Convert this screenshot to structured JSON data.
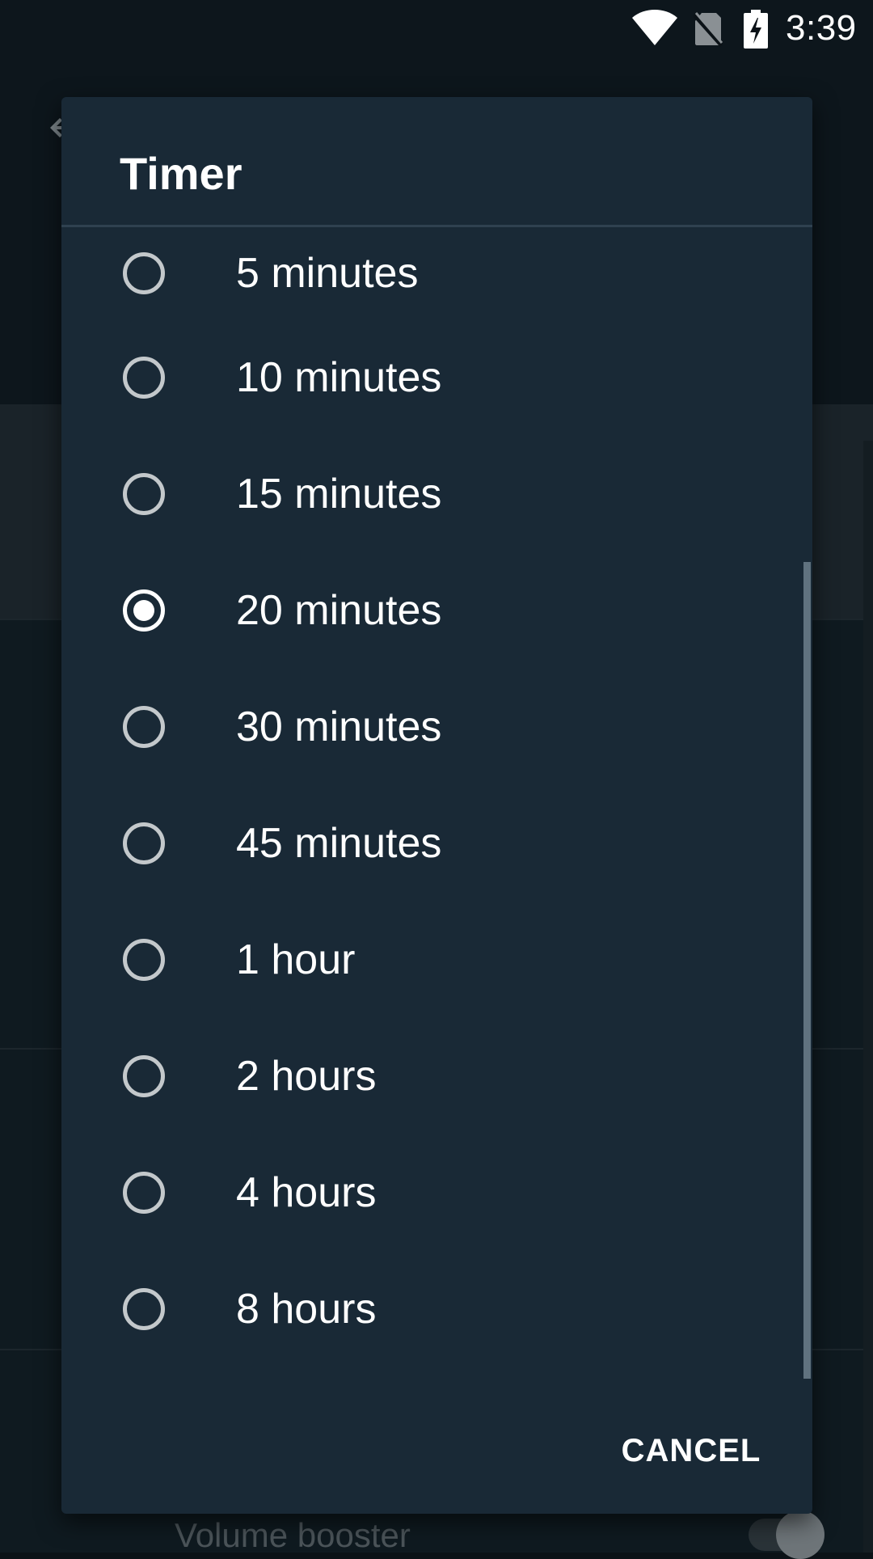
{
  "status_bar": {
    "time": "3:39",
    "icons": [
      "wifi-icon",
      "no-sim-icon",
      "battery-charging-icon"
    ]
  },
  "background": {
    "volume_booster_label": "Volume booster"
  },
  "dialog": {
    "title": "Timer",
    "options": [
      {
        "label": "5 minutes",
        "selected": false
      },
      {
        "label": "10 minutes",
        "selected": false
      },
      {
        "label": "15 minutes",
        "selected": false
      },
      {
        "label": "20 minutes",
        "selected": true
      },
      {
        "label": "30 minutes",
        "selected": false
      },
      {
        "label": "45 minutes",
        "selected": false
      },
      {
        "label": "1 hour",
        "selected": false
      },
      {
        "label": "2 hours",
        "selected": false
      },
      {
        "label": "4 hours",
        "selected": false
      },
      {
        "label": "8 hours",
        "selected": false
      }
    ],
    "cancel_label": "CANCEL"
  },
  "colors": {
    "dialog_background": "#192936",
    "radio_unchecked": "#c3c8cb",
    "radio_checked": "#ffffff",
    "scrollbar": "#60727f"
  }
}
